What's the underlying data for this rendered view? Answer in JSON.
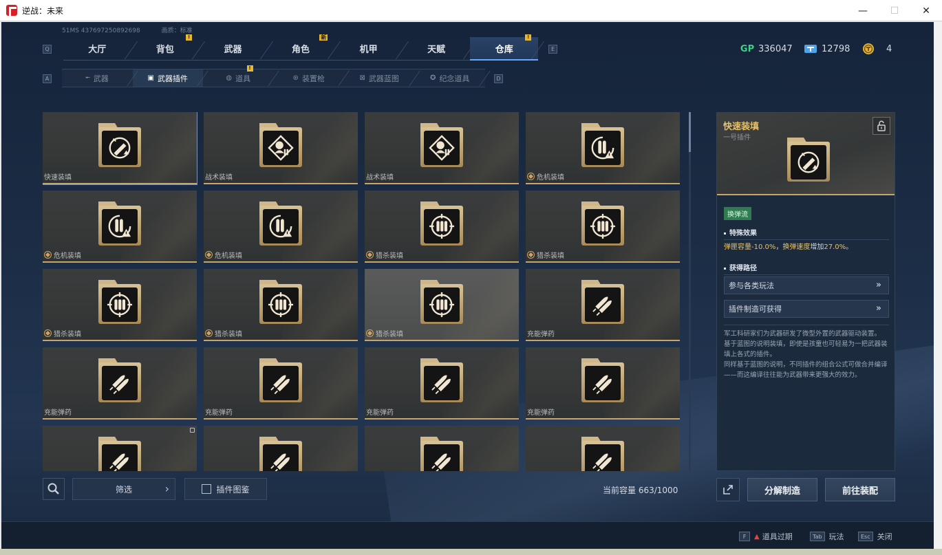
{
  "window": {
    "title": "逆战：未来",
    "controls": {
      "minimize": "—",
      "maximize": "☐",
      "close": "✕"
    }
  },
  "account": {
    "id": "51MS  437697250892698",
    "quality": "画质：标准"
  },
  "hotkeys": {
    "main_prev": "Q",
    "main_next": "E",
    "sub_prev": "A",
    "sub_next": "D"
  },
  "main_tabs": [
    {
      "label": "大厅",
      "badge": ""
    },
    {
      "label": "背包",
      "badge": "!"
    },
    {
      "label": "武器",
      "badge": ""
    },
    {
      "label": "角色",
      "badge": "新"
    },
    {
      "label": "机甲",
      "badge": ""
    },
    {
      "label": "天赋",
      "badge": ""
    },
    {
      "label": "仓库",
      "badge": "!"
    }
  ],
  "currencies": [
    {
      "icon": "gp-icon",
      "label": "GP",
      "value": "336047",
      "color": "#3ed08a"
    },
    {
      "icon": "ticket-icon",
      "value": "12798",
      "color": "#4fa3e8"
    },
    {
      "icon": "coin-icon",
      "value": "4",
      "color": "#e6b53a"
    }
  ],
  "sub_tabs": [
    {
      "label": "武器",
      "icon": "rifle-icon",
      "badge": ""
    },
    {
      "label": "武器插件",
      "icon": "chip-icon",
      "badge": ""
    },
    {
      "label": "道具",
      "icon": "grenade-icon",
      "badge": "!"
    },
    {
      "label": "装置枪",
      "icon": "turret-icon",
      "badge": ""
    },
    {
      "label": "武器蓝图",
      "icon": "blueprint-icon",
      "badge": ""
    },
    {
      "label": "纪念道具",
      "icon": "medal-icon",
      "badge": ""
    }
  ],
  "items": [
    {
      "name": "快速装填",
      "icon": "reload-icon",
      "rare": false,
      "selected": true,
      "locked": false
    },
    {
      "name": "战术装填",
      "icon": "tactical-icon",
      "rare": false,
      "selected": false,
      "locked": false
    },
    {
      "name": "战术装填",
      "icon": "tactical-icon",
      "rare": false,
      "selected": false,
      "locked": false
    },
    {
      "name": "危机装填",
      "icon": "crisis-icon",
      "rare": true,
      "selected": false,
      "locked": false
    },
    {
      "name": "危机装填",
      "icon": "crisis-icon",
      "rare": true,
      "selected": false,
      "locked": false
    },
    {
      "name": "危机装填",
      "icon": "crisis-icon",
      "rare": true,
      "selected": false,
      "locked": false
    },
    {
      "name": "猎杀装填",
      "icon": "hunt-icon",
      "rare": true,
      "selected": false,
      "locked": false
    },
    {
      "name": "猎杀装填",
      "icon": "hunt-icon",
      "rare": true,
      "selected": false,
      "locked": false
    },
    {
      "name": "猎杀装填",
      "icon": "hunt-icon",
      "rare": true,
      "selected": false,
      "locked": false
    },
    {
      "name": "猎杀装填",
      "icon": "hunt-icon",
      "rare": true,
      "selected": false,
      "locked": false
    },
    {
      "name": "猎杀装填",
      "icon": "hunt-icon",
      "rare": true,
      "selected": false,
      "locked": false,
      "highlight": true
    },
    {
      "name": "充能弹药",
      "icon": "ammo-icon",
      "rare": false,
      "selected": false,
      "locked": false
    },
    {
      "name": "充能弹药",
      "icon": "ammo-icon",
      "rare": false,
      "selected": false,
      "locked": false
    },
    {
      "name": "充能弹药",
      "icon": "ammo-icon",
      "rare": false,
      "selected": false,
      "locked": false
    },
    {
      "name": "充能弹药",
      "icon": "ammo-icon",
      "rare": false,
      "selected": false,
      "locked": false
    },
    {
      "name": "充能弹药",
      "icon": "ammo-icon",
      "rare": false,
      "selected": false,
      "locked": false
    },
    {
      "name": "",
      "icon": "ammo-icon",
      "rare": false,
      "selected": false,
      "locked": true
    },
    {
      "name": "",
      "icon": "ammo-icon",
      "rare": false,
      "selected": false,
      "locked": false
    },
    {
      "name": "",
      "icon": "ammo-icon",
      "rare": false,
      "selected": false,
      "locked": false
    },
    {
      "name": "",
      "icon": "ammo-icon",
      "rare": false,
      "selected": false,
      "locked": false
    }
  ],
  "detail": {
    "title": "快速装填",
    "subtitle": "一号插件",
    "lock_icon": "unlock-icon",
    "tag": "换弹流",
    "effect_heading": "特殊效果",
    "effect_parts": [
      {
        "text": "弹匣容量-10.0%",
        "hl": true
      },
      {
        "text": "，",
        "hl": false
      },
      {
        "text": "换弹速度",
        "hl": true
      },
      {
        "text": "增加",
        "hl": false
      },
      {
        "text": "27.0%",
        "hl": true
      },
      {
        "text": "。",
        "hl": false
      }
    ],
    "route_heading": "获得路径",
    "routes": [
      "参与各类玩法",
      "插件制造可获得"
    ],
    "description": [
      "军工科研家们为武器研发了微型外置的武器驱动装置。",
      "基于蓝图的说明装填，即使是孩童也可轻易为一把武器装填上各式的插件。",
      "同样基于蓝图的说明，不同插件的组合公式可做合并编译——而这编译往往能为武器带来更强大的效力。"
    ]
  },
  "bottom": {
    "filter_label": "筛选",
    "atlas_label": "插件图鉴",
    "capacity_label": "当前容量",
    "capacity_value": "663/1000",
    "decompose_label": "分解制造",
    "equip_label": "前往装配"
  },
  "footer_hints": [
    {
      "key": "F",
      "label": "道具过期",
      "warn": true
    },
    {
      "key": "Tab",
      "label": "玩法",
      "warn": false
    },
    {
      "key": "Esc",
      "label": "关闭",
      "warn": false
    }
  ]
}
